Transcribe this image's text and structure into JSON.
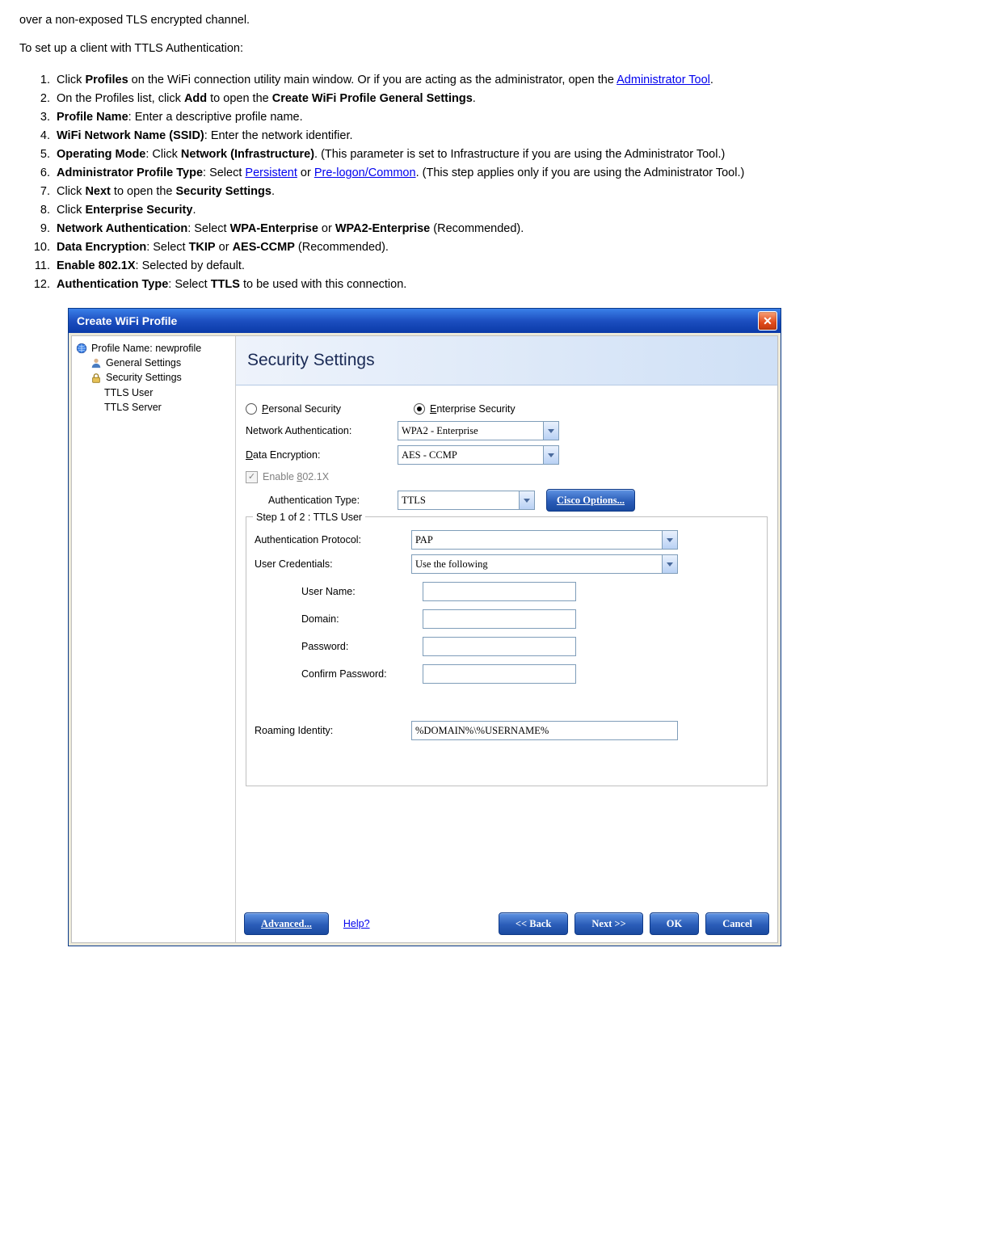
{
  "intro_top": "over a non-exposed TLS encrypted channel.",
  "intro_setup": "To set up a client with TTLS Authentication:",
  "links": {
    "admin_tool": "Administrator Tool",
    "persistent": "Persistent",
    "prelogon": "Pre-logon/Common"
  },
  "steps": {
    "s1_a": "Click ",
    "s1_b": "Profiles",
    "s1_c": " on the WiFi connection utility main window. Or if you are acting as the administrator, open the ",
    "s1_d": ".",
    "s2_a": "On the Profiles list, click ",
    "s2_b": "Add",
    "s2_c": " to open the ",
    "s2_d": "Create WiFi Profile General Settings",
    "s2_e": ".",
    "s3_a": "Profile Name",
    "s3_b": ": Enter a descriptive profile name.",
    "s4_a": "WiFi Network Name (SSID)",
    "s4_b": ": Enter the network identifier.",
    "s5_a": "Operating Mode",
    "s5_b": ": Click ",
    "s5_c": "Network (Infrastructure)",
    "s5_d": ". (This parameter is set to Infrastructure if you are using the Administrator Tool.)",
    "s6_a": "Administrator Profile Type",
    "s6_b": ": Select ",
    "s6_c": " or ",
    "s6_d": ". (This step applies only if you are using the Administrator Tool.)",
    "s7_a": "Click ",
    "s7_b": "Next",
    "s7_c": " to open the ",
    "s7_d": "Security Settings",
    "s7_e": ".",
    "s8_a": "Click ",
    "s8_b": "Enterprise Security",
    "s8_c": ".",
    "s9_a": "Network Authentication",
    "s9_b": ": Select ",
    "s9_c": "WPA-Enterprise",
    "s9_d": " or ",
    "s9_e": "WPA2-Enterprise",
    "s9_f": " (Recommended).",
    "s10_a": "Data Encryption",
    "s10_b": ": Select ",
    "s10_c": "TKIP",
    "s10_d": " or ",
    "s10_e": "AES-CCMP",
    "s10_f": " (Recommended).",
    "s11_a": "Enable 802.1X",
    "s11_b": ": Selected by default.",
    "s12_a": "Authentication Type",
    "s12_b": ": Select ",
    "s12_c": "TTLS",
    "s12_d": " to be used with this connection."
  },
  "dialog": {
    "title": "Create WiFi Profile",
    "tree": {
      "profile": "Profile Name: newprofile",
      "general": "General Settings",
      "security": "Security Settings",
      "ttls_user": "TTLS User",
      "ttls_server": "TTLS Server"
    },
    "banner": "Security Settings",
    "radios": {
      "personal_u": "P",
      "personal": "ersonal Security",
      "enterprise_u": "E",
      "enterprise": "nterprise Security"
    },
    "labels": {
      "net_auth": "Network Authentication:",
      "data_enc_u": "D",
      "data_enc": "ata Encryption:",
      "enable_8021x_pre": "Enable ",
      "enable_8021x_u": "8",
      "enable_8021x_post": "02.1X",
      "auth_type": "Authentication Type:",
      "cisco_u": "C",
      "cisco": "isco Options...",
      "group_legend": "Step 1 of 2 : TTLS User",
      "auth_proto": "Authentication Protocol:",
      "user_cred": "User Credentials:",
      "user_name": "User Name:",
      "domain": "Domain:",
      "password": "Password:",
      "confirm": "Confirm Password:",
      "roaming": "Roaming Identity:"
    },
    "values": {
      "net_auth": "WPA2 - Enterprise",
      "data_enc": "AES - CCMP",
      "auth_type": "TTLS",
      "auth_proto": "PAP",
      "user_cred": "Use the following",
      "user_name": "",
      "domain": "",
      "password": "",
      "confirm": "",
      "roaming": "%DOMAIN%\\%USERNAME%"
    },
    "buttons": {
      "advanced_pre": "Ad",
      "advanced_u": "v",
      "advanced_post": "anced...",
      "help": "Help?",
      "back": "<< Back",
      "next": "Next >>",
      "ok": "OK",
      "cancel": "Cancel"
    }
  }
}
